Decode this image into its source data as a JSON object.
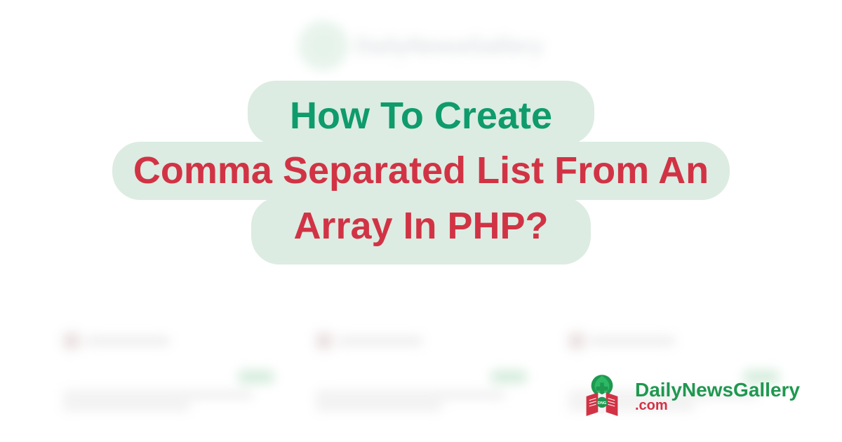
{
  "title": {
    "line1": "How To Create",
    "line2": "Comma Separated List From An",
    "line3": "Array In PHP?"
  },
  "brand": {
    "name_part1": "DailyNewsGallery",
    "name_part2": ".com"
  },
  "colors": {
    "title_green": "#0f9b6c",
    "title_red": "#d13345",
    "pill_bg": "#dcece2",
    "brand_green": "#1f9850",
    "brand_red": "#d13345"
  }
}
